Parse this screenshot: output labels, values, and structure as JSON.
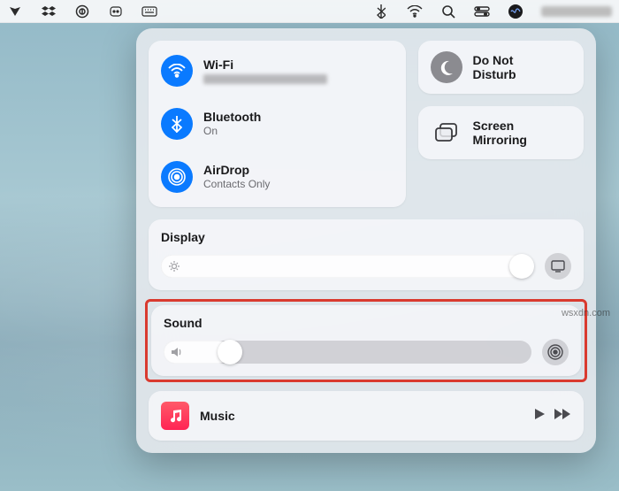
{
  "menubar_icons": [
    "evernote",
    "dropbox",
    "onepassword",
    "discord",
    "keyboard",
    "bluetooth",
    "wifi",
    "search",
    "control-center",
    "siri"
  ],
  "connectivity": {
    "wifi": {
      "label": "Wi-Fi",
      "status": ""
    },
    "bluetooth": {
      "label": "Bluetooth",
      "status": "On"
    },
    "airdrop": {
      "label": "AirDrop",
      "status": "Contacts Only"
    }
  },
  "dnd": {
    "line1": "Do Not",
    "line2": "Disturb"
  },
  "mirroring": {
    "line1": "Screen",
    "line2": "Mirroring"
  },
  "display": {
    "title": "Display",
    "value_pct": 100
  },
  "sound": {
    "title": "Sound",
    "value_pct": 18
  },
  "music": {
    "label": "Music"
  },
  "watermark": "wsxdn.com"
}
